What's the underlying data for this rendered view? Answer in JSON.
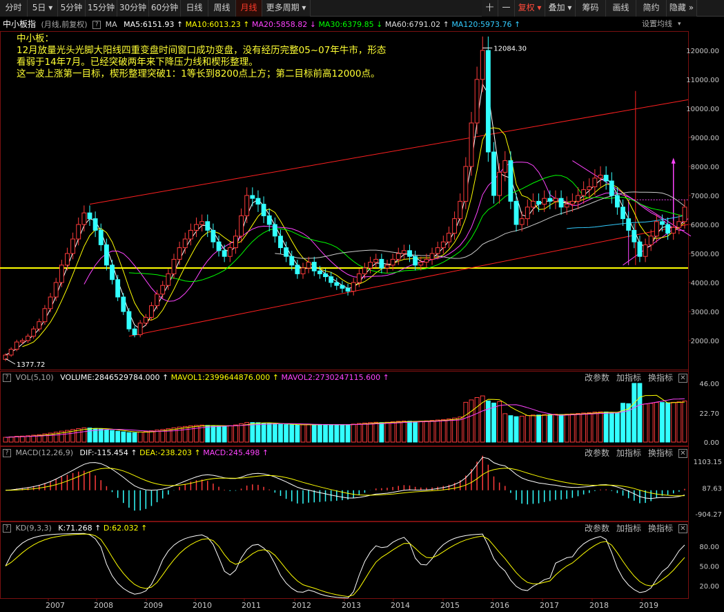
{
  "toolbar": {
    "periods": [
      "分时",
      "5日",
      "5分钟",
      "15分钟",
      "30分钟",
      "60分钟",
      "日线",
      "周线",
      "月线",
      "更多周期"
    ],
    "active": "月线",
    "right": [
      "十",
      "一",
      "复权",
      "叠加",
      "筹码",
      "画线",
      "简约",
      "隐藏"
    ]
  },
  "info": {
    "name": "中小板指",
    "sub": "(月线,前复权)",
    "ma_label": "MA",
    "ma5": "MA5:6151.93",
    "ma10": "MA10:6013.23",
    "ma20": "MA20:5858.82",
    "ma30": "MA30:6379.85",
    "ma60": "MA60:6791.02",
    "ma120": "MA120:5973.76",
    "settings": "设置均线"
  },
  "annotation": {
    "l1": "中小板：",
    "l2": "12月放量光头光脚大阳线四重变盘时间窗口成功变盘，没有经历完整05~07年牛市，形态",
    "l3": "看弱于14年7月。已经突破两年来下降压力线和楔形整理。",
    "l4": "这一波上涨第一目标，楔形整理突破1：1等长到8200点上方；第二目标前高12000点。"
  },
  "price_axis": {
    "ticks": [
      "12000.00",
      "11000.00",
      "10000.00",
      "9000.00",
      "8000.00",
      "7000.00",
      "6000.00",
      "5000.00",
      "4000.00",
      "3000.00",
      "2000.00"
    ],
    "high_label": "12084.30",
    "low_label": "1377.72"
  },
  "vol": {
    "title": "VOL(5,10)",
    "volume": "VOLUME:2846529784.000",
    "mavol1": "MAVOL1:2399644876.000",
    "mavol2": "MAVOL2:2730247115.600",
    "ticks": [
      "46.00",
      "22.70",
      "0.00"
    ]
  },
  "macd": {
    "title": "MACD(12,26,9)",
    "dif": "DIF:-115.454",
    "dea": "DEA:-238.203",
    "macd": "MACD:245.498",
    "ticks": [
      "1103.15",
      "87.63",
      "-904.27"
    ]
  },
  "kd": {
    "title": "KD(9,3,3)",
    "k": "K:71.268",
    "d": "D:62.032",
    "ticks": [
      "80.00",
      "50.00",
      "20.00"
    ]
  },
  "panel_buttons": {
    "params": "改参数",
    "add": "加指标",
    "switch": "换指标",
    "close": "✕"
  },
  "years": [
    "2007",
    "2008",
    "2009",
    "2010",
    "2011",
    "2012",
    "2013",
    "2014",
    "2015",
    "2016",
    "2017",
    "2018",
    "2019"
  ],
  "colors": {
    "up": "#ff3b3b",
    "down": "#33ffff",
    "ma5": "#ffffff",
    "ma10": "#ffff00",
    "ma20": "#ff44ff",
    "ma30": "#00ff00",
    "ma120": "#33ccff",
    "channel": "#ff2020",
    "support": "#ffff00"
  },
  "chart_data": {
    "type": "candlestick",
    "title": "中小板指 月线",
    "ylim": [
      1300,
      12500
    ],
    "key_levels": {
      "high": 12084.3,
      "low": 1377.72,
      "support": 4500
    },
    "closes": [
      1500,
      1700,
      1950,
      2000,
      2150,
      2400,
      2650,
      3100,
      3500,
      4000,
      4600,
      5000,
      5500,
      6000,
      6400,
      6200,
      5800,
      5300,
      4600,
      4100,
      3500,
      3000,
      2400,
      2200,
      2600,
      2800,
      3200,
      3600,
      3900,
      4300,
      4800,
      5200,
      5500,
      5800,
      6000,
      6100,
      5800,
      5400,
      5100,
      4900,
      5200,
      5600,
      6300,
      7000,
      6900,
      6700,
      6300,
      6000,
      5600,
      5200,
      4900,
      4600,
      4300,
      4500,
      4700,
      4400,
      4300,
      4200,
      4000,
      3900,
      3800,
      3700,
      4000,
      4300,
      4500,
      4700,
      4800,
      4500,
      4600,
      4800,
      5000,
      5100,
      4900,
      4600,
      4700,
      4800,
      5000,
      5200,
      5400,
      5700,
      6200,
      6800,
      8000,
      9500,
      11000,
      12000,
      8500,
      7000,
      7800,
      8200,
      6800,
      6000,
      6200,
      6600,
      6800,
      6700,
      6900,
      6800,
      6900,
      6600,
      6700,
      6800,
      7000,
      7200,
      7300,
      7600,
      7700,
      7500,
      7000,
      6600,
      6200,
      5800,
      5400,
      4900,
      5300,
      5600,
      6100,
      6000,
      5700,
      5900,
      6100,
      6600
    ],
    "macd_hist_note": "bar histogram, red positive / cyan negative",
    "kd_note": "K white, D yellow oscillator 0-100"
  }
}
